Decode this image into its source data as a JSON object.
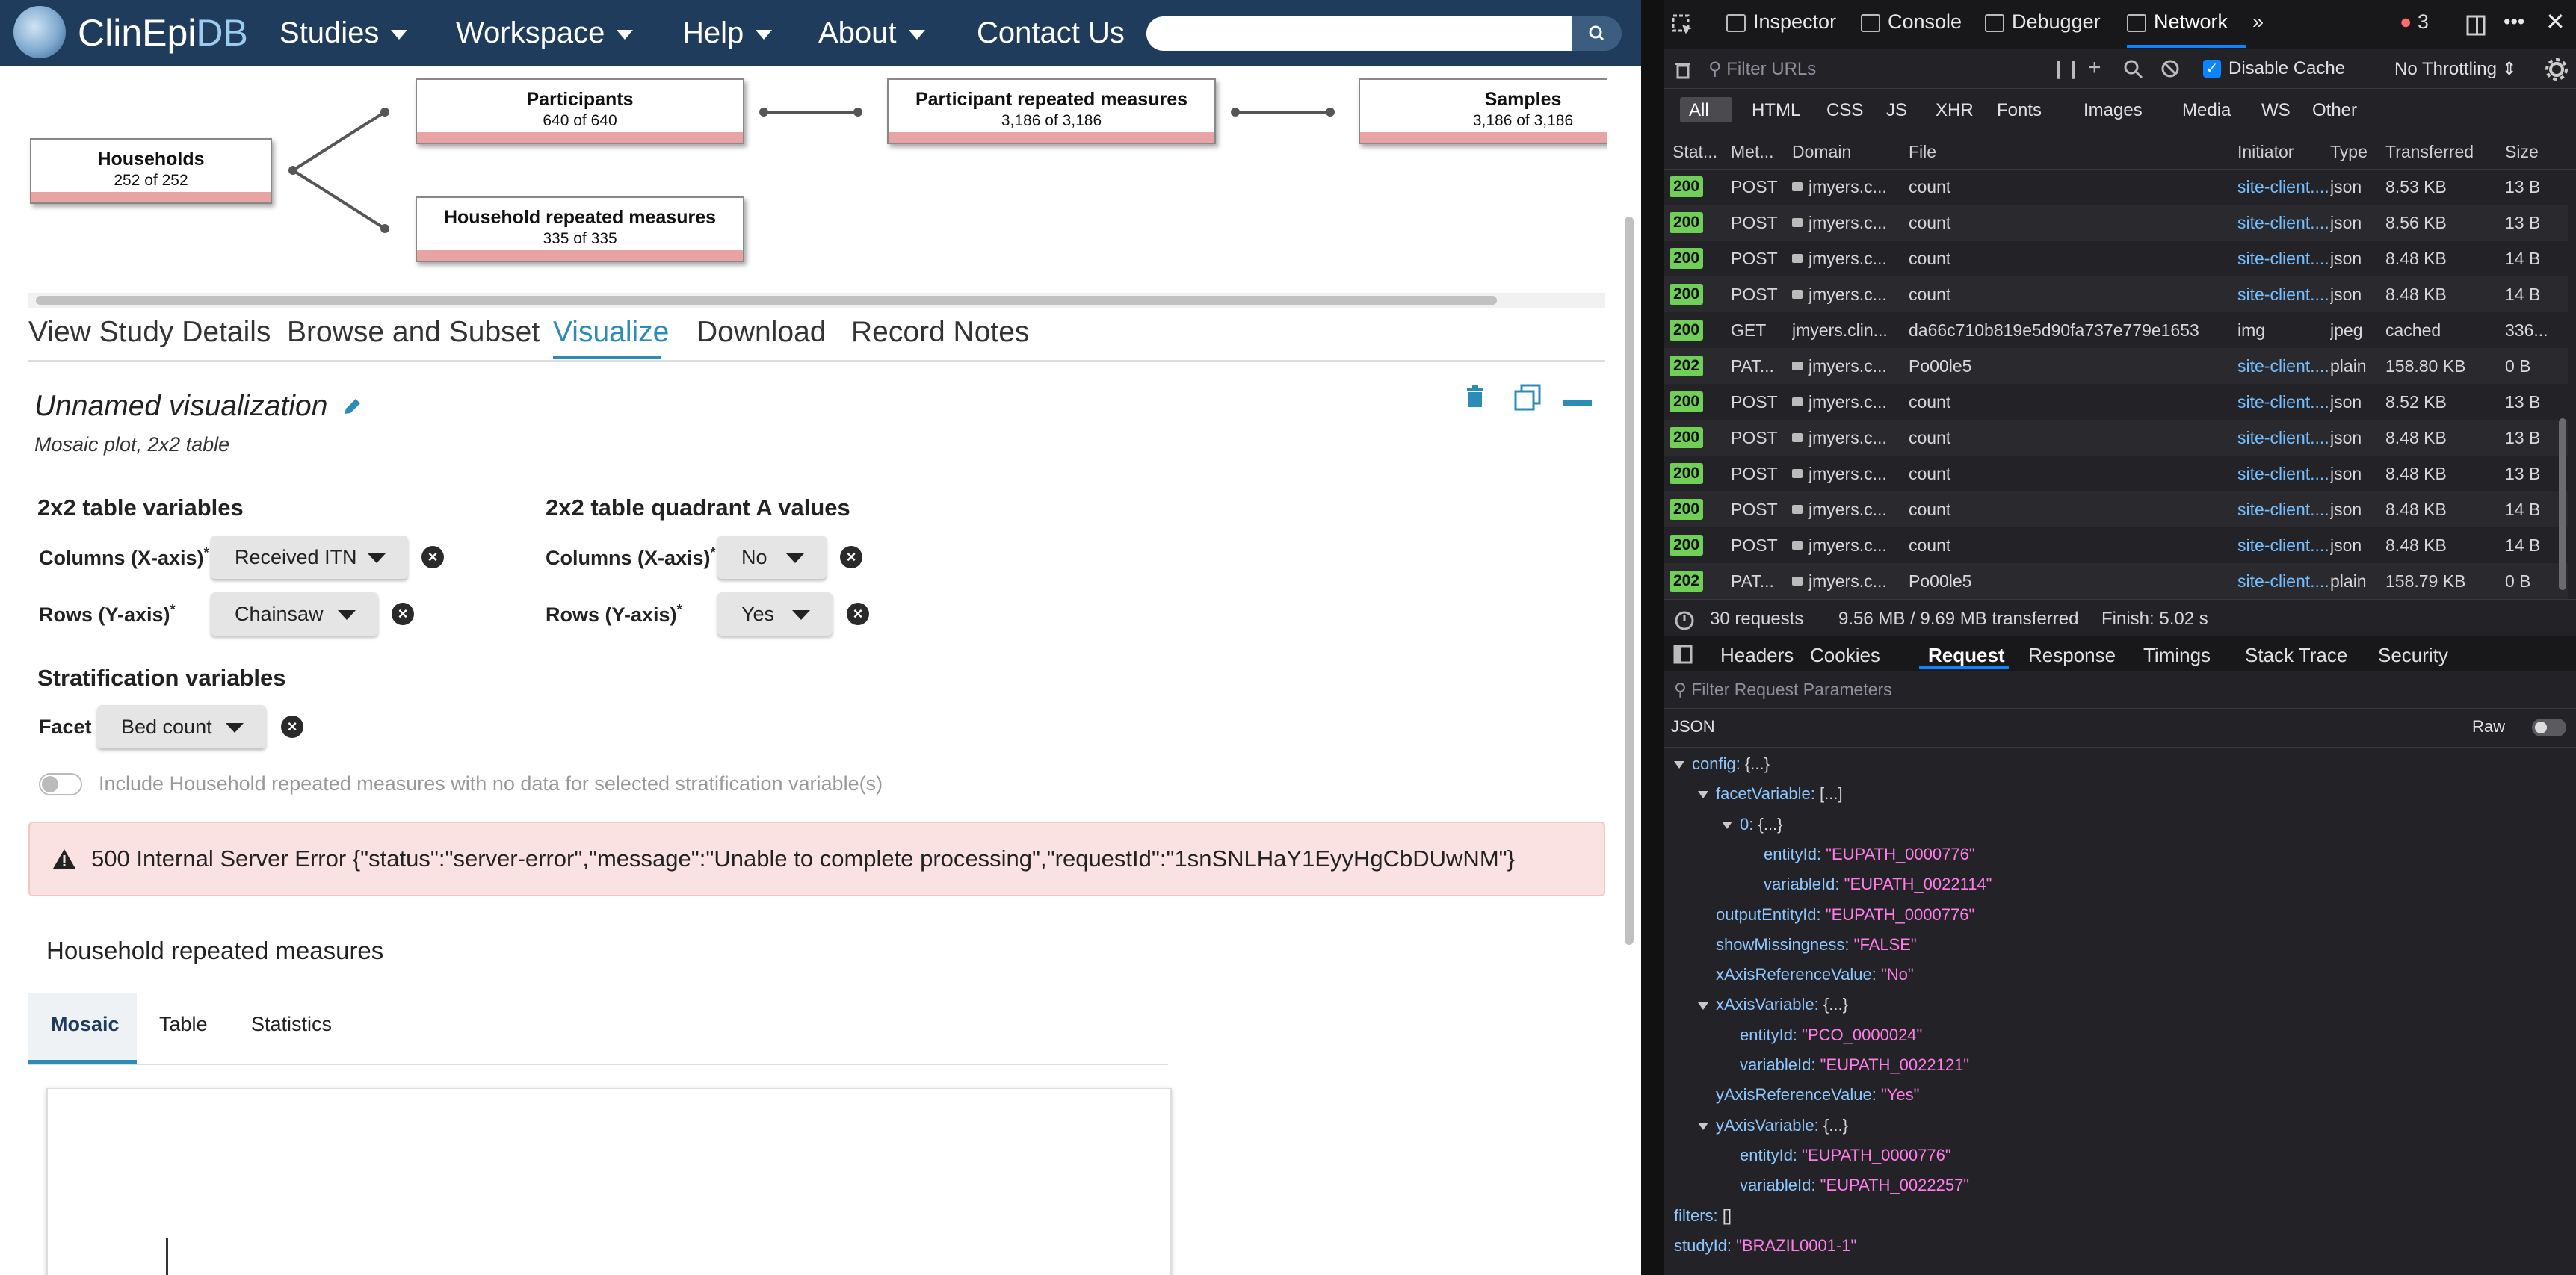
{
  "app": {
    "logo": {
      "name_main": "ClinEpi",
      "name_suffix": "DB"
    },
    "nav": [
      {
        "label": "Studies",
        "caret": true
      },
      {
        "label": "Workspace",
        "caret": true
      },
      {
        "label": "Help",
        "caret": true
      },
      {
        "label": "About",
        "caret": true
      },
      {
        "label": "Contact Us",
        "caret": false
      }
    ],
    "search": {
      "placeholder": ""
    },
    "diagram": {
      "households": {
        "title": "Households",
        "count": "252 of 252"
      },
      "participants": {
        "title": "Participants",
        "count": "640 of 640"
      },
      "participant_repeated": {
        "title": "Participant repeated measures",
        "count": "3,186 of 3,186"
      },
      "samples": {
        "title": "Samples",
        "count": "3,186 of 3,186"
      },
      "household_repeated": {
        "title": "Household repeated measures",
        "count": "335 of 335"
      }
    },
    "tabs": [
      "View Study Details",
      "Browse and Subset",
      "Visualize",
      "Download",
      "Record Notes"
    ],
    "active_tab": "Visualize",
    "viz": {
      "title": "Unnamed visualization",
      "subtitle": "Mosaic plot, 2x2 table",
      "table_vars_heading": "2x2 table variables",
      "quadrant_heading": "2x2 table quadrant A values",
      "columns_label": "Columns (X-axis)",
      "rows_label": "Rows (Y-axis)",
      "required_mark": "*",
      "columns_value": "Received ITN",
      "rows_value": "Chainsaw",
      "quad_columns_value": "No",
      "quad_rows_value": "Yes",
      "strat_heading": "Stratification variables",
      "facet_label": "Facet",
      "facet_value": "Bed count",
      "toggle_label": "Include Household repeated measures with no data for selected stratification variable(s)",
      "error_text": "500 Internal Server Error {\"status\":\"server-error\",\"message\":\"Unable to complete processing\",\"requestId\":\"1snSNLHaY1EyyHgCbDUwNM\"}",
      "entity_heading": "Household repeated measures",
      "plot_tabs": [
        "Mosaic",
        "Table",
        "Statistics"
      ]
    }
  },
  "devtools": {
    "toolbar": [
      "Inspector",
      "Console",
      "Debugger",
      "Network"
    ],
    "error_count": "3",
    "filter_placeholder": "Filter URLs",
    "disable_cache": "Disable Cache",
    "throttling": "No Throttling",
    "type_filters": [
      "All",
      "HTML",
      "CSS",
      "JS",
      "XHR",
      "Fonts",
      "Images",
      "Media",
      "WS",
      "Other"
    ],
    "columns": [
      "Stat...",
      "Met...",
      "Domain",
      "File",
      "Initiator",
      "Type",
      "Transferred",
      "Size"
    ],
    "rows": [
      {
        "status": "200",
        "method": "POST",
        "domain": "jmyers.c...",
        "file": "count",
        "initiator": "site-client....",
        "type": "json",
        "transferred": "8.53 KB",
        "size": "13 B",
        "lock": true
      },
      {
        "status": "200",
        "method": "POST",
        "domain": "jmyers.c...",
        "file": "count",
        "initiator": "site-client....",
        "type": "json",
        "transferred": "8.56 KB",
        "size": "13 B",
        "lock": true
      },
      {
        "status": "200",
        "method": "POST",
        "domain": "jmyers.c...",
        "file": "count",
        "initiator": "site-client....",
        "type": "json",
        "transferred": "8.48 KB",
        "size": "14 B",
        "lock": true
      },
      {
        "status": "200",
        "method": "POST",
        "domain": "jmyers.c...",
        "file": "count",
        "initiator": "site-client....",
        "type": "json",
        "transferred": "8.48 KB",
        "size": "14 B",
        "lock": true
      },
      {
        "status": "200",
        "method": "GET",
        "domain": "jmyers.clin...",
        "file": "da66c710b819e5d90fa737e779e1653",
        "initiator": "img",
        "type": "jpeg",
        "transferred": "cached",
        "size": "336...",
        "lock": false
      },
      {
        "status": "202",
        "method": "PAT...",
        "domain": "jmyers.c...",
        "file": "Po00le5",
        "initiator": "site-client....",
        "type": "plain",
        "transferred": "158.80 KB",
        "size": "0 B",
        "lock": true
      },
      {
        "status": "200",
        "method": "POST",
        "domain": "jmyers.c...",
        "file": "count",
        "initiator": "site-client....",
        "type": "json",
        "transferred": "8.52 KB",
        "size": "13 B",
        "lock": true
      },
      {
        "status": "200",
        "method": "POST",
        "domain": "jmyers.c...",
        "file": "count",
        "initiator": "site-client....",
        "type": "json",
        "transferred": "8.48 KB",
        "size": "13 B",
        "lock": true
      },
      {
        "status": "200",
        "method": "POST",
        "domain": "jmyers.c...",
        "file": "count",
        "initiator": "site-client....",
        "type": "json",
        "transferred": "8.48 KB",
        "size": "13 B",
        "lock": true
      },
      {
        "status": "200",
        "method": "POST",
        "domain": "jmyers.c...",
        "file": "count",
        "initiator": "site-client....",
        "type": "json",
        "transferred": "8.48 KB",
        "size": "14 B",
        "lock": true
      },
      {
        "status": "200",
        "method": "POST",
        "domain": "jmyers.c...",
        "file": "count",
        "initiator": "site-client....",
        "type": "json",
        "transferred": "8.48 KB",
        "size": "14 B",
        "lock": true
      },
      {
        "status": "202",
        "method": "PAT...",
        "domain": "jmyers.c...",
        "file": "Po00le5",
        "initiator": "site-client....",
        "type": "plain",
        "transferred": "158.79 KB",
        "size": "0 B",
        "lock": true
      }
    ],
    "summary": {
      "requests": "30 requests",
      "transferred": "9.56 MB / 9.69 MB transferred",
      "finish": "Finish: 5.02 s"
    },
    "detail_tabs": [
      "Headers",
      "Cookies",
      "Request",
      "Response",
      "Timings",
      "Stack Trace",
      "Security"
    ],
    "active_detail_tab": "Request",
    "filter_params_placeholder": "Filter Request Parameters",
    "json_label": "JSON",
    "raw_label": "Raw",
    "json_lines": [
      {
        "indent": 0,
        "toggle": true,
        "key": "config:",
        "val": "{...}",
        "val_type": "dim"
      },
      {
        "indent": 1,
        "toggle": true,
        "key": "facetVariable:",
        "val": "[...]",
        "val_type": "dim"
      },
      {
        "indent": 2,
        "toggle": true,
        "key": "0:",
        "val": "{...}",
        "val_type": "dim"
      },
      {
        "indent": 3,
        "toggle": false,
        "key": "entityId:",
        "val": "\"EUPATH_0000776\"",
        "val_type": "str"
      },
      {
        "indent": 3,
        "toggle": false,
        "key": "variableId:",
        "val": "\"EUPATH_0022114\"",
        "val_type": "str"
      },
      {
        "indent": 1,
        "toggle": false,
        "key": "outputEntityId:",
        "val": "\"EUPATH_0000776\"",
        "val_type": "str"
      },
      {
        "indent": 1,
        "toggle": false,
        "key": "showMissingness:",
        "val": "\"FALSE\"",
        "val_type": "str"
      },
      {
        "indent": 1,
        "toggle": false,
        "key": "xAxisReferenceValue:",
        "val": "\"No\"",
        "val_type": "str"
      },
      {
        "indent": 1,
        "toggle": true,
        "key": "xAxisVariable:",
        "val": "{...}",
        "val_type": "dim"
      },
      {
        "indent": 2,
        "toggle": false,
        "key": "entityId:",
        "val": "\"PCO_0000024\"",
        "val_type": "str"
      },
      {
        "indent": 2,
        "toggle": false,
        "key": "variableId:",
        "val": "\"EUPATH_0022121\"",
        "val_type": "str"
      },
      {
        "indent": 1,
        "toggle": false,
        "key": "yAxisReferenceValue:",
        "val": "\"Yes\"",
        "val_type": "str"
      },
      {
        "indent": 1,
        "toggle": true,
        "key": "yAxisVariable:",
        "val": "{...}",
        "val_type": "dim"
      },
      {
        "indent": 2,
        "toggle": false,
        "key": "entityId:",
        "val": "\"EUPATH_0000776\"",
        "val_type": "str"
      },
      {
        "indent": 2,
        "toggle": false,
        "key": "variableId:",
        "val": "\"EUPATH_0022257\"",
        "val_type": "str"
      },
      {
        "indent": 0,
        "toggle": false,
        "key": "filters:",
        "val": "[]",
        "val_type": "dim"
      },
      {
        "indent": 0,
        "toggle": false,
        "key": "studyId:",
        "val": "\"BRAZIL0001-1\"",
        "val_type": "str"
      }
    ],
    "colors": {
      "status_ok": "#6fcf57",
      "link": "#75bfff",
      "json_string": "#ff7de9",
      "error_bg": "#fbe2e2"
    }
  }
}
